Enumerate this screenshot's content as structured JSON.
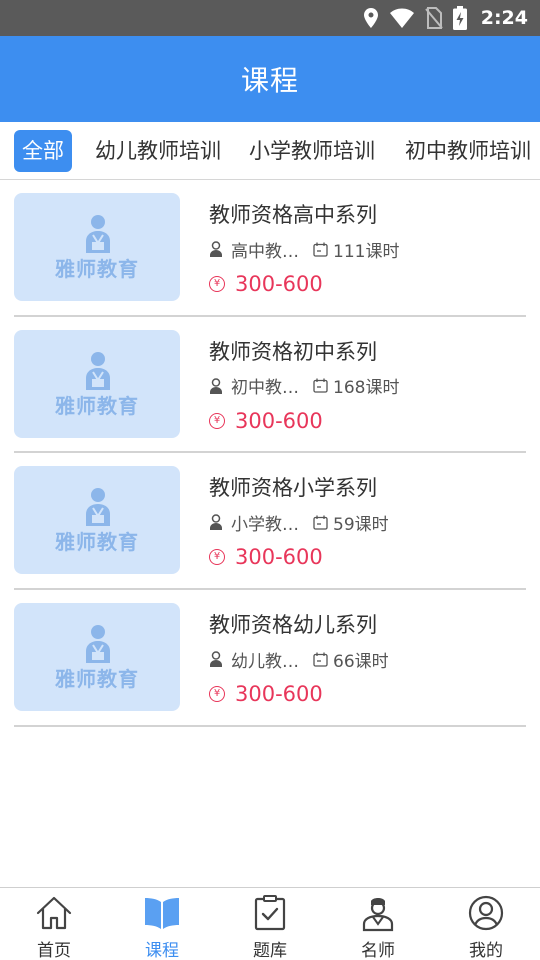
{
  "status_bar": {
    "time": "2:24"
  },
  "header": {
    "title": "课程"
  },
  "tabs": [
    {
      "label": "全部",
      "active": true
    },
    {
      "label": "幼儿教师培训",
      "active": false
    },
    {
      "label": "小学教师培训",
      "active": false
    },
    {
      "label": "初中教师培训",
      "active": false
    }
  ],
  "courses": [
    {
      "thumb_label": "雅师教育",
      "title": "教师资格高中系列",
      "category": "高中教师资格",
      "hours": "111课时",
      "price": "300-600"
    },
    {
      "thumb_label": "雅师教育",
      "title": "教师资格初中系列",
      "category": "初中教师资格",
      "hours": "168课时",
      "price": "300-600"
    },
    {
      "thumb_label": "雅师教育",
      "title": "教师资格小学系列",
      "category": "小学教师资格",
      "hours": "59课时",
      "price": "300-600"
    },
    {
      "thumb_label": "雅师教育",
      "title": "教师资格幼儿系列",
      "category": "幼儿教师资格",
      "hours": "66课时",
      "price": "300-600"
    }
  ],
  "price_symbol": "¥",
  "bottom_nav": [
    {
      "label": "首页",
      "icon": "home-icon",
      "active": false
    },
    {
      "label": "课程",
      "icon": "book-icon",
      "active": true
    },
    {
      "label": "题库",
      "icon": "checklist-icon",
      "active": false
    },
    {
      "label": "名师",
      "icon": "teacher-icon",
      "active": false
    },
    {
      "label": "我的",
      "icon": "profile-icon",
      "active": false
    }
  ],
  "colors": {
    "primary": "#3d8ef0",
    "price": "#e8365a",
    "thumb_bg": "#d2e4fa",
    "thumb_text": "#8cb6ea",
    "status_bar": "#5a5a5a"
  }
}
